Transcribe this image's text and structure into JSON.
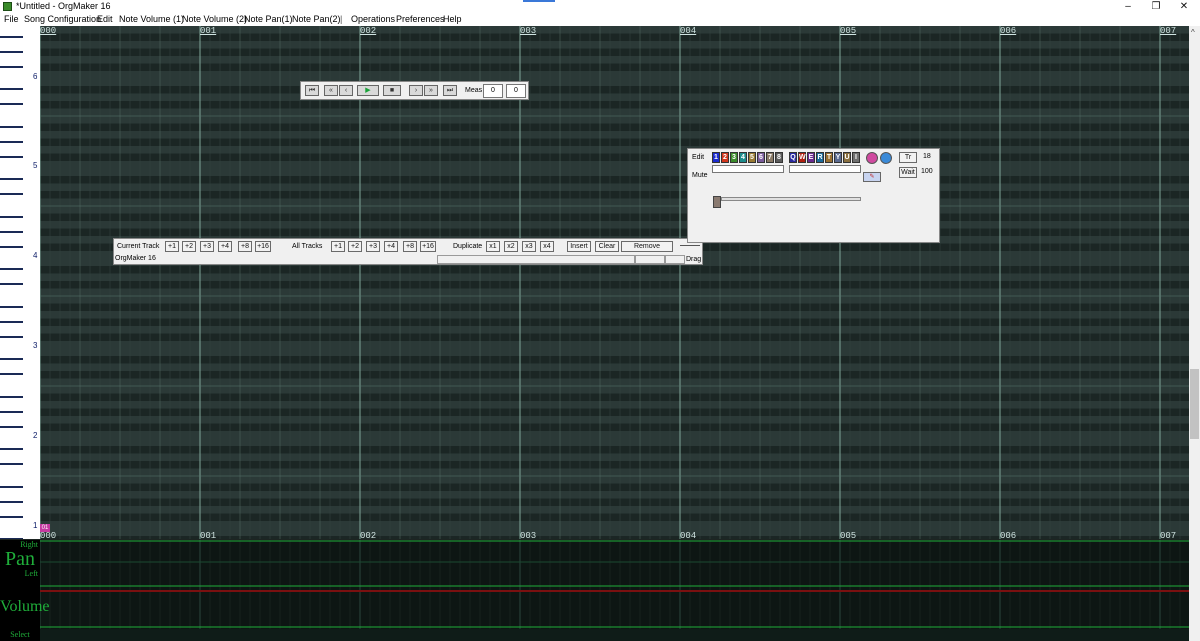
{
  "window": {
    "title": "*Untitled - OrgMaker 16",
    "controls": {
      "minimize": "–",
      "maximize": "❐",
      "close": "✕"
    }
  },
  "menu": [
    {
      "label": "File"
    },
    {
      "label": "Song Configuration"
    },
    {
      "label": "Edit"
    },
    {
      "label": "Note Volume (1)"
    },
    {
      "label": "Note Volume (2)"
    },
    {
      "label": "Note Pan(1)"
    },
    {
      "label": "Note Pan(2)"
    },
    {
      "label": "|"
    },
    {
      "label": "Operations"
    },
    {
      "label": "Preferences"
    },
    {
      "label": "Help"
    }
  ],
  "piano": {
    "octave_labels": [
      "6",
      "5",
      "4",
      "3",
      "2",
      "1"
    ]
  },
  "measures": {
    "top": [
      "000",
      "001",
      "002",
      "003",
      "004",
      "005",
      "006",
      "007"
    ],
    "bottom": [
      "000",
      "001",
      "002",
      "003",
      "004",
      "005",
      "006",
      "007"
    ]
  },
  "playback": {
    "meas_label": "Meas",
    "meas_value": "0",
    "beat_value": "0"
  },
  "track_toolbar": {
    "current_track_label": "Current Track",
    "current_buttons": [
      "+1",
      "+2",
      "+3",
      "+4",
      "+8",
      "+16"
    ],
    "all_tracks_label": "All Tracks",
    "all_buttons": [
      "+1",
      "+2",
      "+3",
      "+4",
      "+8",
      "+16"
    ],
    "duplicate_label": "Duplicate",
    "dup_buttons": [
      "x1",
      "x2",
      "x3",
      "x4"
    ],
    "insert_label": "Insert",
    "clear_label": "Clear",
    "remove_label": "Remove",
    "status_text": "OrgMaker 16",
    "drag_label": "Drag"
  },
  "track_panel": {
    "edit_label": "Edit",
    "mute_label": "Mute",
    "melody_tracks": [
      "1",
      "2",
      "3",
      "4",
      "5",
      "6",
      "7",
      "8"
    ],
    "drum_tracks": [
      "Q",
      "W",
      "E",
      "R",
      "T",
      "Y",
      "U",
      "I"
    ],
    "tr_label": "Tr",
    "tr_value": "18",
    "wait_label": "Wait",
    "wait_value": "100"
  },
  "bottom_panels": {
    "pan_right": "Right",
    "pan_title": "Pan",
    "pan_left": "Left",
    "volume_title": "Volume",
    "select_label": "Select",
    "marker": "01"
  },
  "colors": {
    "roll_bg": "#233130",
    "melody_keys": [
      "#1b2bd0",
      "#d1361c",
      "#3b8b2a",
      "#1e8c8c",
      "#9a7b33",
      "#7b5c9c",
      "#8a7a66",
      "#5a5a5a"
    ],
    "drum_keys": [
      "#2a2aa0",
      "#b02010",
      "#6a2a90",
      "#1a6a9a",
      "#9a7030",
      "#5a6a90",
      "#8a7040",
      "#707070"
    ]
  }
}
